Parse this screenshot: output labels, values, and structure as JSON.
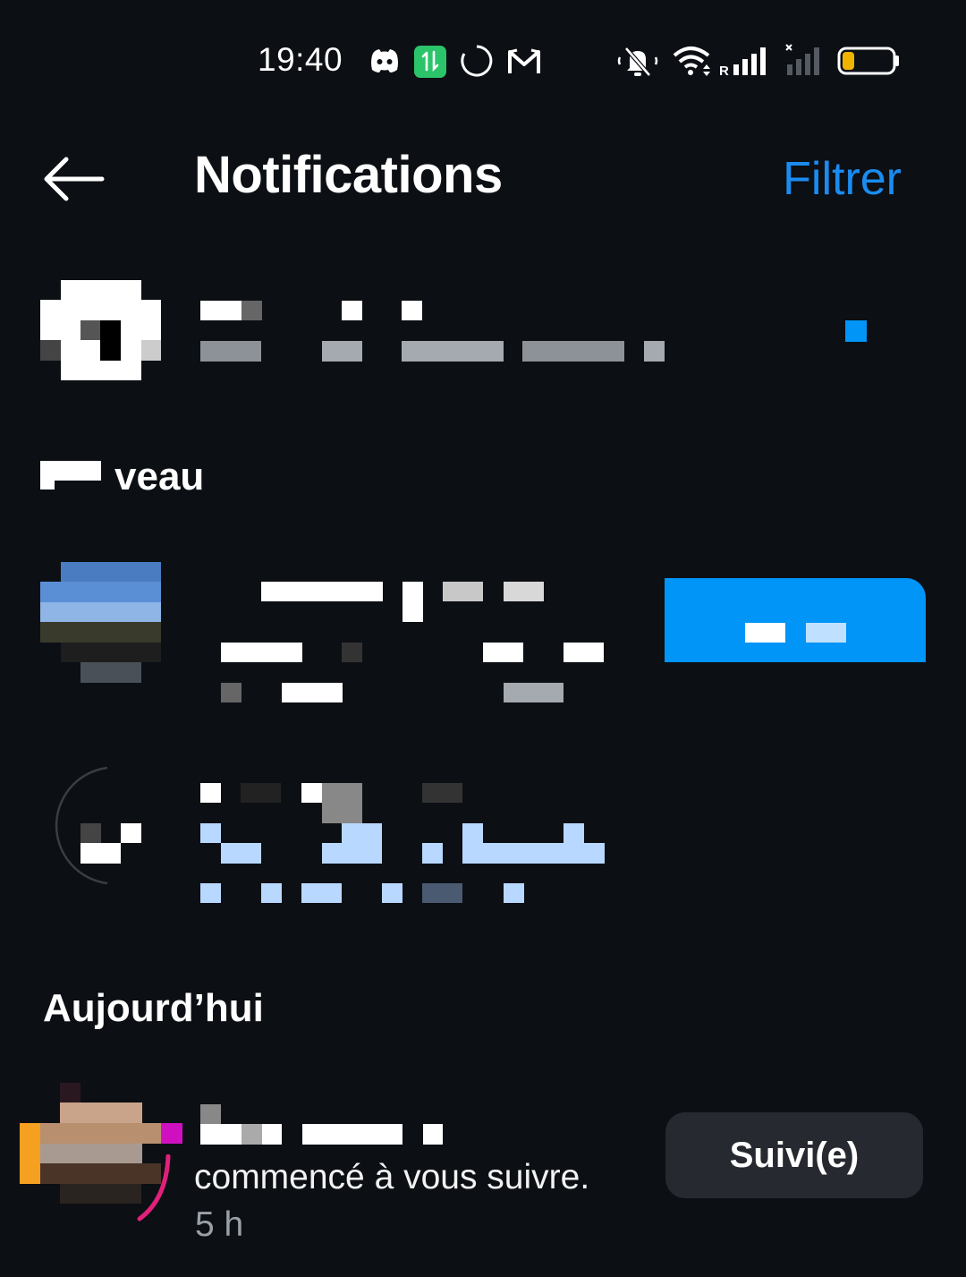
{
  "status_bar": {
    "time": "19:40",
    "icons": [
      "discord-icon",
      "data-transfer-icon",
      "loading-ring-icon",
      "gmail-icon",
      "mute-icon",
      "wifi-icon",
      "signal-r-icon",
      "signal-none-icon",
      "battery-icon"
    ],
    "roaming_letter": "R",
    "battery_level": 0.2
  },
  "header": {
    "title": "Notifications",
    "filter_label": "Filtrer"
  },
  "sections": {
    "new_label": "veau",
    "today_label": "Aujourd’hui"
  },
  "today_item": {
    "text": "commencé à vous suivre.",
    "time": "5 h",
    "button_label": "Suivi(e)"
  },
  "colors": {
    "background": "#0c0f14",
    "accent": "#0095f6",
    "filter": "#1a8cf0",
    "button_bg": "#26292f"
  }
}
